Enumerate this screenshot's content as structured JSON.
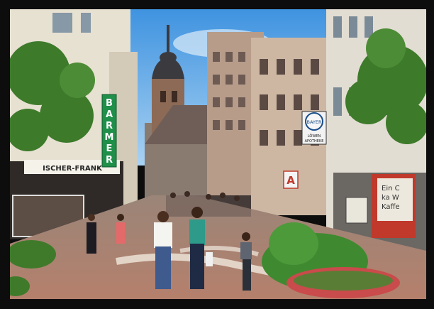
{
  "photo": {
    "type": "vintage postcard photograph",
    "signs": {
      "barmer_vertical": "BARMER",
      "shop_left": "ISCHER-FRANK",
      "bayer_logo": "BAYER",
      "apotheke_line1": "LÖWEN",
      "apotheke_line2": "APOTHEKE",
      "pharmacy_symbol": "A",
      "poster_line1": "Ein C",
      "poster_line2": "ka W",
      "poster_line3": "Kaffe"
    }
  },
  "colors": {
    "sky": "#5aa6e6",
    "barmer_sign": "#1f8f4a",
    "pavement": "#b48a78",
    "shop_awning_red": "#c0392b",
    "foliage": "#3d7a2a"
  }
}
